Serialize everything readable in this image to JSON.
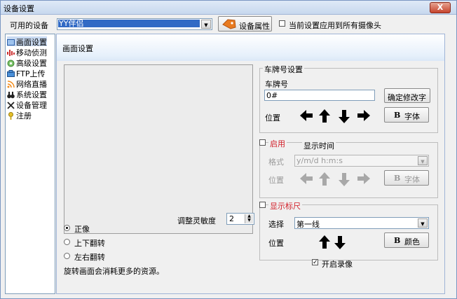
{
  "window": {
    "title": "设备设置",
    "close_glyph": "X"
  },
  "device_row": {
    "label": "可用的设备",
    "device_value": "YY伴侣",
    "properties_button": "设备属性",
    "apply_all_label": "当前设置应用到所有摄像头"
  },
  "sidebar": {
    "items": [
      {
        "label": "画面设置",
        "icon": "screen-icon"
      },
      {
        "label": "移动侦测",
        "icon": "motion-icon"
      },
      {
        "label": "高级设置",
        "icon": "advanced-icon"
      },
      {
        "label": "FTP上传",
        "icon": "ftp-icon"
      },
      {
        "label": "网络直播",
        "icon": "broadcast-icon"
      },
      {
        "label": "系统设置",
        "icon": "binoculars-icon"
      },
      {
        "label": "设备管理",
        "icon": "tools-icon"
      },
      {
        "label": "注册",
        "icon": "key-icon"
      }
    ]
  },
  "main": {
    "title": "画面设置",
    "plate": {
      "group_label": "车牌号设置",
      "field_label": "车牌号",
      "field_value": "0#",
      "confirm_button": "确定修改字",
      "position_label": "位置",
      "font_button_b": "B",
      "font_button_label": "字体"
    },
    "time": {
      "enable_label": "启用",
      "group_label": "显示时间",
      "format_label": "格式",
      "format_value": "y/m/d h:m:s",
      "position_label": "位置",
      "font_button_b": "B",
      "font_button_label": "字体"
    },
    "ruler": {
      "group_label": "显示标尺",
      "select_label": "选择",
      "select_value": "第一线",
      "position_label": "位置",
      "color_button_b": "B",
      "color_button_label": "颜色"
    },
    "sensitivity": {
      "label": "调整灵敏度",
      "value": "2"
    },
    "rotation": {
      "options": [
        "正像",
        "上下翻转",
        "左右翻转"
      ],
      "selected": 0
    },
    "note": "旋转画面会消耗更多的资源。",
    "record_label": "开启录像"
  },
  "colors": {
    "accent_red": "#d2202a",
    "title_bar": "#c7d8ee",
    "selection": "#316ac5"
  }
}
